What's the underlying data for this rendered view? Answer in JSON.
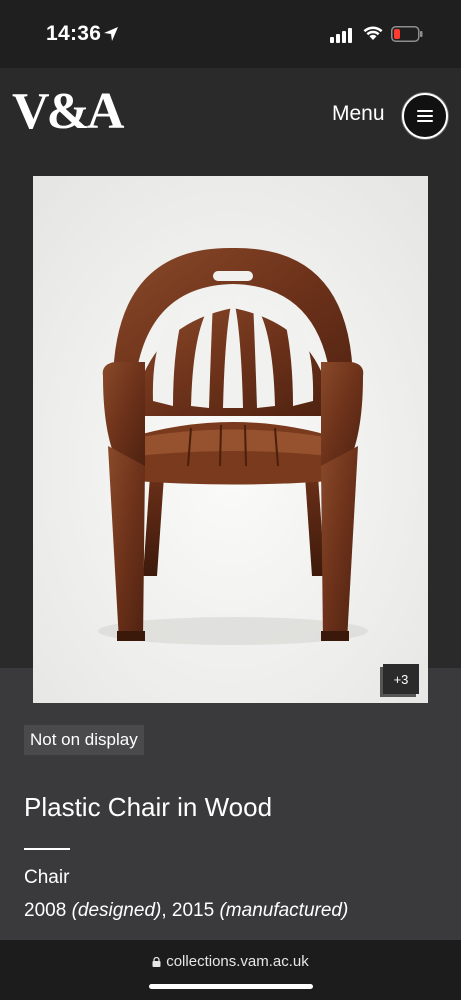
{
  "status_bar": {
    "time": "14:36"
  },
  "header": {
    "logo": "V&A",
    "menu_label": "Menu"
  },
  "object": {
    "more_images": "+3",
    "display_status": "Not on display",
    "title": "Plastic Chair in Wood",
    "type": "Chair",
    "date_designed": "2008",
    "label_designed": "(designed)",
    "date_separator": ", ",
    "date_manufactured": "2015",
    "label_manufactured": "(manufactured)"
  },
  "browser": {
    "url": "collections.vam.ac.uk"
  },
  "colors": {
    "header_bg": "#2a2a2b",
    "content_bg": "#3a3a3c",
    "battery_low": "#ff3b30"
  }
}
